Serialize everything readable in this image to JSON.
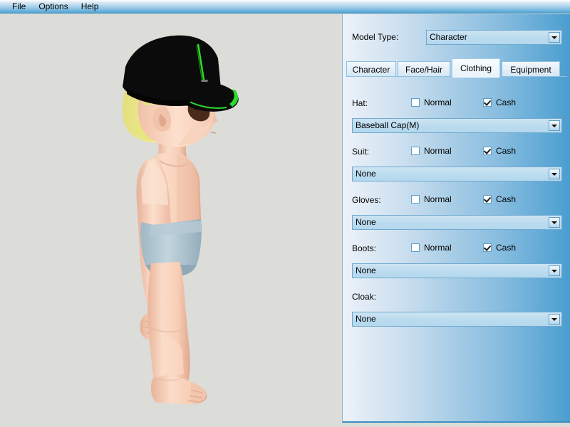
{
  "menubar": {
    "items": [
      {
        "label": "File"
      },
      {
        "label": "Options"
      },
      {
        "label": "Help"
      }
    ]
  },
  "panel": {
    "model_type": {
      "label": "Model Type:",
      "value": "Character",
      "arrow_icon": "chevron-down-icon"
    },
    "tabs": [
      {
        "label": "Character",
        "selected": false
      },
      {
        "label": "Face/Hair",
        "selected": false
      },
      {
        "label": "Clothing",
        "selected": true
      },
      {
        "label": "Equipment",
        "selected": false
      }
    ],
    "checkbox_labels": {
      "normal": "Normal",
      "cash": "Cash"
    },
    "rows": [
      {
        "label": "Hat:",
        "normal_checked": false,
        "cash_checked": true,
        "value": "Baseball Cap(M)"
      },
      {
        "label": "Suit:",
        "normal_checked": false,
        "cash_checked": true,
        "value": "None"
      },
      {
        "label": "Gloves:",
        "normal_checked": false,
        "cash_checked": true,
        "value": "None"
      },
      {
        "label": "Boots:",
        "normal_checked": false,
        "cash_checked": true,
        "value": "None"
      },
      {
        "label": "Cloak:",
        "has_checkboxes": false,
        "value": "None"
      }
    ]
  },
  "viewport": {
    "description": "character-3d-preview",
    "colors": {
      "background": "#dcdcd8",
      "skin": "#f6cdb6",
      "skin_shadow": "#e2ab92",
      "hair": "#ece88a",
      "hat": "#0b0b0b",
      "hat_accent": "#2bdb2b",
      "shorts": "#aec4cf"
    }
  }
}
